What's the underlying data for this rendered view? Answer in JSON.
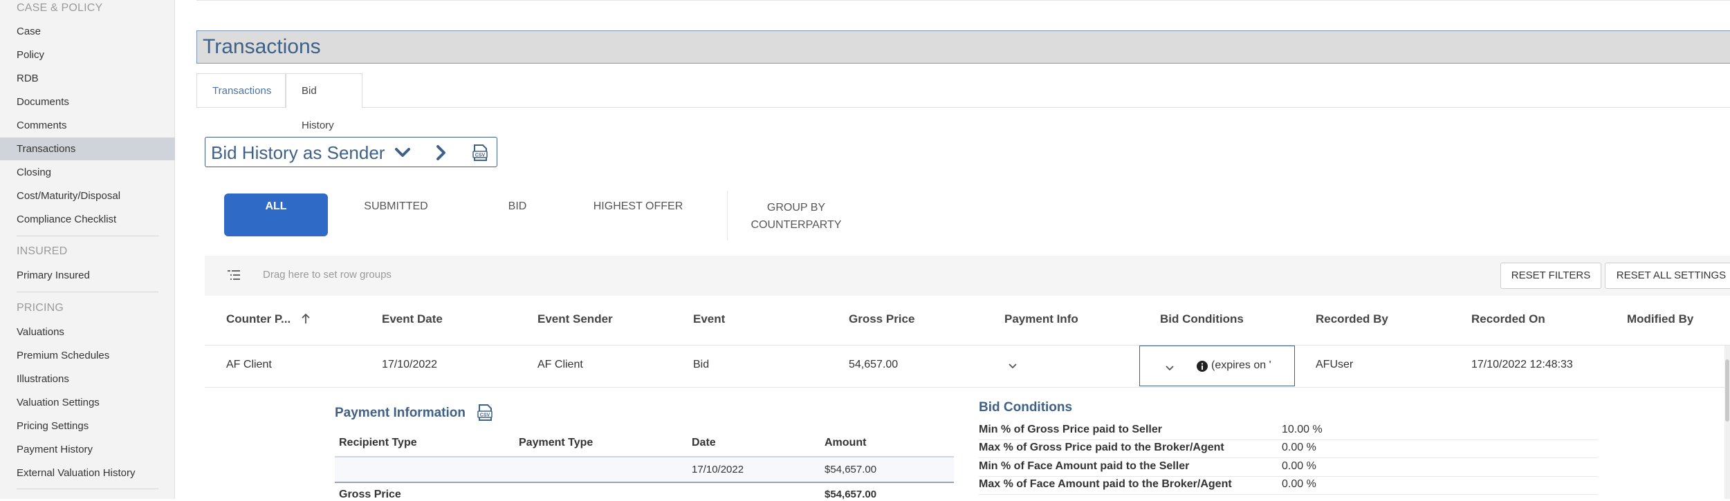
{
  "sidebar": {
    "sections": [
      {
        "title": "CASE & POLICY"
      },
      {
        "title": "INSURED"
      },
      {
        "title": "PRICING"
      }
    ],
    "items_case": [
      "Case",
      "Policy",
      "RDB",
      "Documents",
      "Comments",
      "Transactions",
      "Closing",
      "Cost/Maturity/Disposal",
      "Compliance Checklist"
    ],
    "items_insured": [
      "Primary Insured"
    ],
    "items_pricing": [
      "Valuations",
      "Premium Schedules",
      "Illustrations",
      "Valuation Settings",
      "Pricing Settings",
      "Payment History",
      "External Valuation History"
    ],
    "active": "Transactions"
  },
  "page": {
    "title": "Transactions",
    "tabs": [
      "Transactions",
      "Bid History"
    ],
    "active_tab": "Bid History"
  },
  "view": {
    "title": "Bid History as Sender",
    "icons": [
      "chevron-down-icon",
      "chevron-right-icon",
      "csv-export-icon"
    ]
  },
  "filters": {
    "all": "ALL",
    "submitted": "SUBMITTED",
    "bid": "BID",
    "highest": "HIGHEST OFFER",
    "group_line1": "GROUP BY",
    "group_line2": "COUNTERPARTY"
  },
  "groupbar": {
    "hint": "Drag here to set row groups",
    "reset_filters": "RESET FILTERS",
    "reset_all": "RESET ALL SETTINGS"
  },
  "grid": {
    "columns": [
      "Counter P...",
      "Event Date",
      "Event Sender",
      "Event",
      "Gross Price",
      "Payment Info",
      "Bid Conditions",
      "Recorded By",
      "Recorded On",
      "Modified By"
    ],
    "row": {
      "counterparty": "AF Client",
      "event_date": "17/10/2022",
      "event_sender": "AF Client",
      "event": "Bid",
      "gross_price": "54,657.00",
      "bid_conditions": "(expires on '",
      "recorded_by": "AFUser",
      "recorded_on": "17/10/2022 12:48:33"
    }
  },
  "payment_info": {
    "title": "Payment Information",
    "headers": [
      "Recipient Type",
      "Payment Type",
      "Date",
      "Amount"
    ],
    "row1": {
      "date": "17/10/2022",
      "amount": "$54,657.00"
    },
    "total_label": "Gross Price",
    "total_amount": "$54,657.00"
  },
  "bid_conditions": {
    "title": "Bid Conditions",
    "rows": [
      {
        "label": "Min % of Gross Price paid to Seller",
        "value": "10.00 %"
      },
      {
        "label": "Max % of Gross Price paid to the Broker/Agent",
        "value": "0.00 %"
      },
      {
        "label": "Min % of Face Amount paid to the Seller",
        "value": "0.00 %"
      },
      {
        "label": "Max % of Face Amount paid to the Broker/Agent",
        "value": "0.00 %"
      }
    ]
  },
  "colors": {
    "accent": "#2f6ac6",
    "title_blue": "#3f6188",
    "sidebar_bg": "#f3f3f3",
    "active_item": "#cfd4da"
  }
}
